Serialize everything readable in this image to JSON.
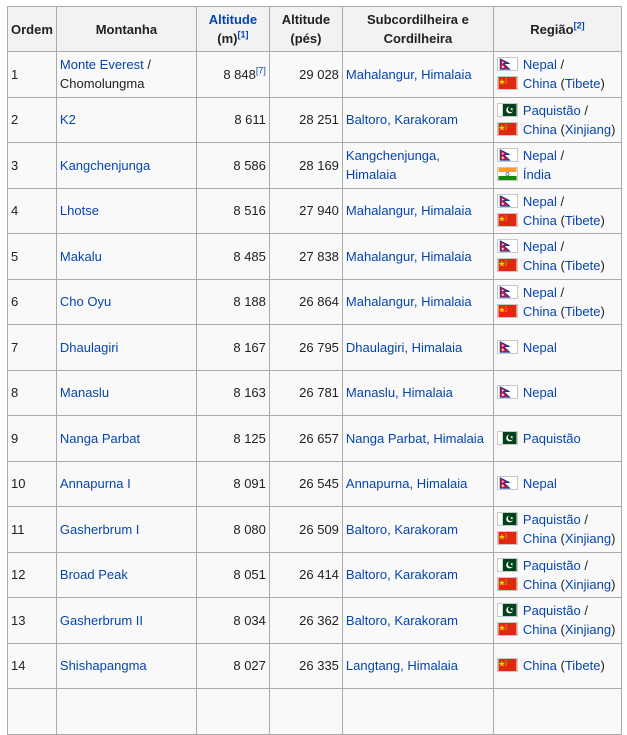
{
  "headers": {
    "ordem": "Ordem",
    "montanha": "Montanha",
    "altitude_m_1": "Altitude",
    "altitude_m_2": "(m)",
    "altitude_m_ref": "[1]",
    "altitude_ft_1": "Altitude",
    "altitude_ft_2": "(pés)",
    "sub_1": "Subcordilheira e",
    "sub_2": "Cordilheira",
    "regiao": "Região",
    "regiao_ref": "[2]"
  },
  "rows": [
    {
      "ordem": "1",
      "montanha": "Monte Everest",
      "montanha_sep": " / ",
      "montanha_alt": "Chomolungma",
      "m": "8 848",
      "m_ref": "[7]",
      "ft": "29 028",
      "sub": "Mahalangur, Himalaia",
      "regions": [
        {
          "flag": "nepal",
          "name": "Nepal",
          "suffix": " /"
        },
        {
          "flag": "china",
          "name": "China",
          "paren": "Tibete"
        }
      ]
    },
    {
      "ordem": "2",
      "montanha": "K2",
      "m": "8 611",
      "ft": "28 251",
      "sub": "Baltoro, Karakoram",
      "regions": [
        {
          "flag": "pakistan",
          "name": "Paquistão",
          "suffix": " /"
        },
        {
          "flag": "china",
          "name": "China",
          "paren": "Xinjiang"
        }
      ]
    },
    {
      "ordem": "3",
      "montanha": "Kangchenjunga",
      "m": "8 586",
      "ft": "28 169",
      "sub": "Kangchenjunga,",
      "sub2": "Himalaia",
      "regions": [
        {
          "flag": "nepal",
          "name": "Nepal",
          "suffix": " /"
        },
        {
          "flag": "india",
          "name": "Índia"
        }
      ]
    },
    {
      "ordem": "4",
      "montanha": "Lhotse",
      "m": "8 516",
      "ft": "27 940",
      "sub": "Mahalangur, Himalaia",
      "regions": [
        {
          "flag": "nepal",
          "name": "Nepal",
          "suffix": " /"
        },
        {
          "flag": "china",
          "name": "China",
          "paren": "Tibete"
        }
      ]
    },
    {
      "ordem": "5",
      "montanha": "Makalu",
      "m": "8 485",
      "ft": "27 838",
      "sub": "Mahalangur, Himalaia",
      "regions": [
        {
          "flag": "nepal",
          "name": "Nepal",
          "suffix": " /"
        },
        {
          "flag": "china",
          "name": "China",
          "paren": "Tibete"
        }
      ]
    },
    {
      "ordem": "6",
      "montanha": "Cho Oyu",
      "m": "8 188",
      "ft": "26 864",
      "sub": "Mahalangur, Himalaia",
      "regions": [
        {
          "flag": "nepal",
          "name": "Nepal",
          "suffix": " /"
        },
        {
          "flag": "china",
          "name": "China",
          "paren": "Tibete"
        }
      ]
    },
    {
      "ordem": "7",
      "montanha": "Dhaulagiri",
      "m": "8 167",
      "ft": "26 795",
      "sub": "Dhaulagiri, Himalaia",
      "regions": [
        {
          "flag": "nepal",
          "name": "Nepal"
        }
      ]
    },
    {
      "ordem": "8",
      "montanha": "Manaslu",
      "m": "8 163",
      "ft": "26 781",
      "sub": "Manaslu, Himalaia",
      "regions": [
        {
          "flag": "nepal",
          "name": "Nepal"
        }
      ]
    },
    {
      "ordem": "9",
      "montanha": "Nanga Parbat",
      "m": "8 125",
      "ft": "26 657",
      "sub": "Nanga Parbat, Himalaia",
      "regions": [
        {
          "flag": "pakistan",
          "name": "Paquistão"
        }
      ]
    },
    {
      "ordem": "10",
      "montanha": "Annapurna I",
      "m": "8 091",
      "ft": "26 545",
      "sub": "Annapurna, Himalaia",
      "regions": [
        {
          "flag": "nepal",
          "name": "Nepal"
        }
      ]
    },
    {
      "ordem": "11",
      "montanha": "Gasherbrum I",
      "m": "8 080",
      "ft": "26 509",
      "sub": "Baltoro, Karakoram",
      "regions": [
        {
          "flag": "pakistan",
          "name": "Paquistão",
          "suffix": " /"
        },
        {
          "flag": "china",
          "name": "China",
          "paren": "Xinjiang"
        }
      ]
    },
    {
      "ordem": "12",
      "montanha": "Broad Peak",
      "m": "8 051",
      "ft": "26 414",
      "sub": "Baltoro, Karakoram",
      "regions": [
        {
          "flag": "pakistan",
          "name": "Paquistão",
          "suffix": " /"
        },
        {
          "flag": "china",
          "name": "China",
          "paren": "Xinjiang"
        }
      ]
    },
    {
      "ordem": "13",
      "montanha": "Gasherbrum II",
      "m": "8 034",
      "ft": "26 362",
      "sub": "Baltoro, Karakoram",
      "regions": [
        {
          "flag": "pakistan",
          "name": "Paquistão",
          "suffix": " /"
        },
        {
          "flag": "china",
          "name": "China",
          "paren": "Xinjiang"
        }
      ]
    },
    {
      "ordem": "14",
      "montanha": "Shishapangma",
      "m": "8 027",
      "ft": "26 335",
      "sub": "Langtang, Himalaia",
      "regions": [
        {
          "flag": "china",
          "name": "China",
          "paren": "Tibete"
        }
      ]
    }
  ],
  "colors": {
    "link": "#0645ad",
    "header_bg": "#f2f2f2",
    "cell_bg": "#f9f9f9",
    "border": "#aaaaaa"
  }
}
